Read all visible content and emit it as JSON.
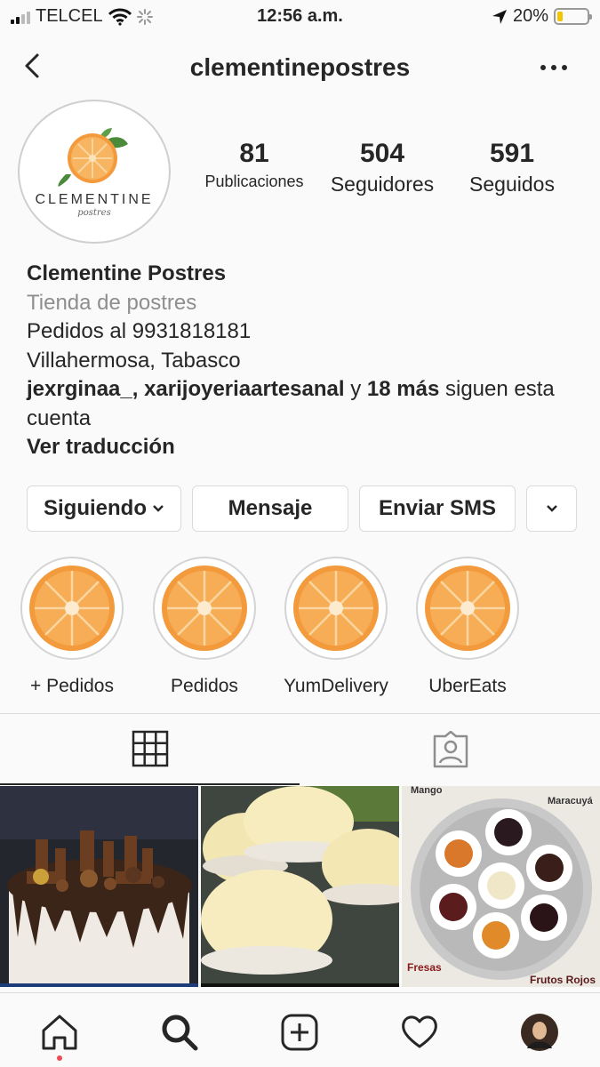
{
  "status_bar": {
    "carrier": "TELCEL",
    "time": "12:56 a.m.",
    "battery": "20%",
    "battery_level": 0.2
  },
  "header": {
    "username": "clementinepostres"
  },
  "profile": {
    "logo_text": "CLEMENTINE",
    "logo_subtext": "postres",
    "stats": [
      {
        "value": "81",
        "label": "Publicaciones"
      },
      {
        "value": "504",
        "label": "Seguidores"
      },
      {
        "value": "591",
        "label": "Seguidos"
      }
    ],
    "name": "Clementine Postres",
    "category": "Tienda de postres",
    "bio_lines": [
      "Pedidos al 9931818181",
      "Villahermosa, Tabasco"
    ],
    "followed_by": {
      "users": "jexrginaa_, xarijoyeriaartesanal",
      "connector": " y ",
      "more": "18 más",
      "suffix": " siguen esta cuenta"
    },
    "translate": "Ver traducción"
  },
  "buttons": {
    "following": "Siguiendo",
    "message": "Mensaje",
    "sms": "Enviar SMS"
  },
  "highlights": [
    {
      "label": "+ Pedidos"
    },
    {
      "label": "Pedidos"
    },
    {
      "label": "YumDelivery"
    },
    {
      "label": "UberEats"
    }
  ],
  "grid_posts": [
    {
      "depicts": "chocolate drip cake"
    },
    {
      "depicts": "alfajores"
    },
    {
      "depicts": "jam tartlets",
      "labels": [
        "Mango",
        "Maracuyá",
        "Fresas",
        "Frutos Rojos"
      ]
    }
  ],
  "colors": {
    "orange": "#f39a3c",
    "accent_red": "#ed4956",
    "text": "#262626",
    "muted": "#8e8e8e"
  }
}
